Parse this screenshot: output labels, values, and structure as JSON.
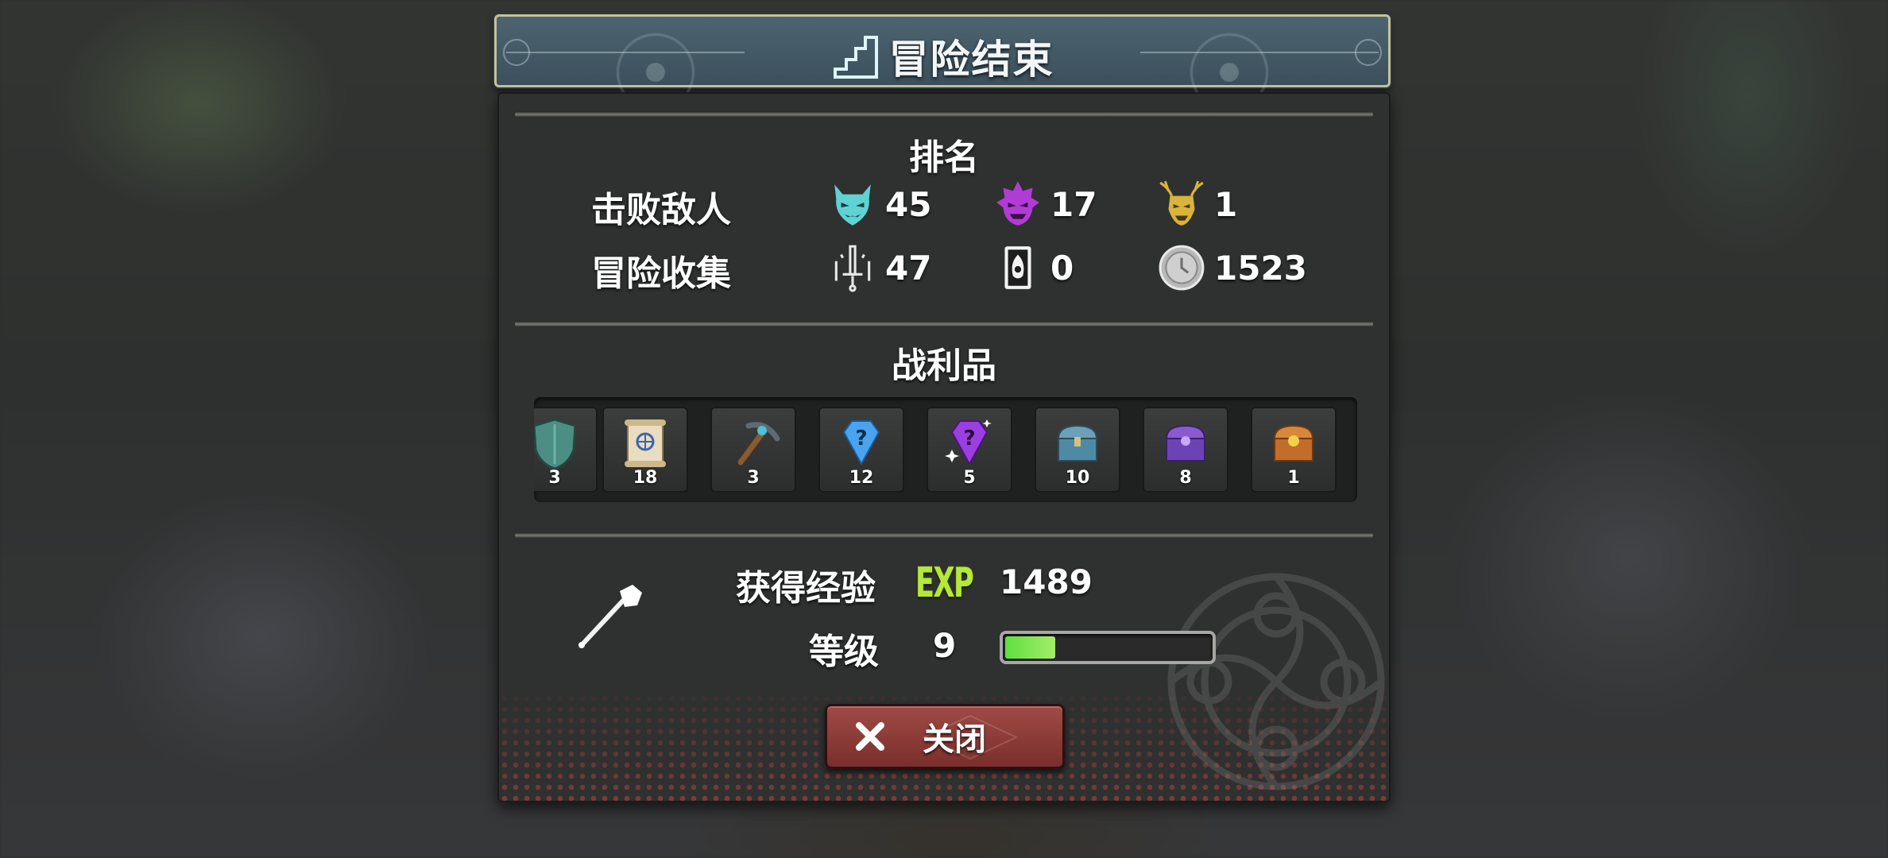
{
  "header": {
    "title": "冒险结束"
  },
  "ranking": {
    "title": "排名",
    "defeated_label": "击败敌人",
    "collect_label": "冒险收集",
    "defeated": [
      {
        "icon": "cyan-demon-mask-icon",
        "value": "45"
      },
      {
        "icon": "purple-demon-mask-icon",
        "value": "17"
      },
      {
        "icon": "gold-demon-mask-icon",
        "value": "1"
      }
    ],
    "collected": [
      {
        "icon": "sword-icon",
        "value": "47"
      },
      {
        "icon": "card-icon",
        "value": "0"
      },
      {
        "icon": "silver-coin-icon",
        "value": "1523"
      }
    ]
  },
  "loot": {
    "title": "战利品",
    "items": [
      {
        "icon": "teal-shield-icon",
        "count": "3"
      },
      {
        "icon": "scroll-icon",
        "count": "18"
      },
      {
        "icon": "pickaxe-icon",
        "count": "3"
      },
      {
        "icon": "blue-mystery-gem-icon",
        "count": "12"
      },
      {
        "icon": "purple-mystery-gem-icon",
        "count": "5"
      },
      {
        "icon": "blue-chest-icon",
        "count": "10"
      },
      {
        "icon": "purple-chest-icon",
        "count": "8"
      },
      {
        "icon": "gold-chest-icon",
        "count": "1"
      }
    ]
  },
  "exp": {
    "label": "获得经验",
    "badge": "EXP",
    "value": "1489",
    "level_label": "等级",
    "level": "9",
    "level_progress": 0.26
  },
  "close_button": {
    "label": "关闭"
  },
  "colors": {
    "accent_green": "#b6e83a",
    "close_red": "#8f3d39",
    "banner": "#3f5561"
  }
}
